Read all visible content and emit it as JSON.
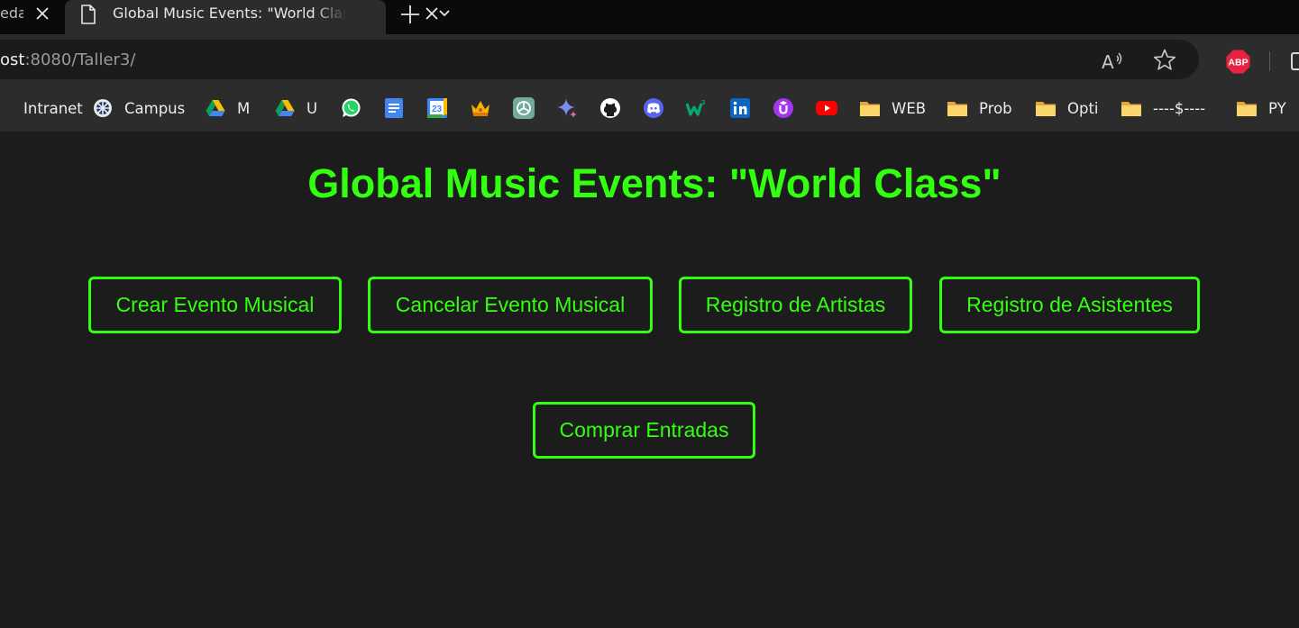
{
  "browser": {
    "tabs": [
      {
        "title": "eda",
        "active": false
      },
      {
        "title": "Global Music Events: \"World Class\"",
        "active": true
      }
    ],
    "address": {
      "host": "ost",
      "path": ":8080/Taller3/"
    },
    "extensions": {
      "abp_label": "ABP"
    },
    "bookmarks": [
      {
        "label": "Intranet",
        "icon": "partial-icon"
      },
      {
        "label": "Campus",
        "icon": "wheel-icon"
      },
      {
        "label": "M",
        "icon": "google-drive-icon"
      },
      {
        "label": "U",
        "icon": "google-drive-icon"
      },
      {
        "label": "",
        "icon": "whatsapp-icon"
      },
      {
        "label": "",
        "icon": "google-docs-icon"
      },
      {
        "label": "",
        "icon": "google-calendar-icon"
      },
      {
        "label": "",
        "icon": "crown-icon"
      },
      {
        "label": "",
        "icon": "chatgpt-icon"
      },
      {
        "label": "",
        "icon": "gemini-icon"
      },
      {
        "label": "",
        "icon": "github-icon"
      },
      {
        "label": "",
        "icon": "discord-icon"
      },
      {
        "label": "",
        "icon": "w3schools-icon"
      },
      {
        "label": "",
        "icon": "linkedin-icon"
      },
      {
        "label": "",
        "icon": "udemy-icon"
      },
      {
        "label": "",
        "icon": "youtube-icon"
      },
      {
        "label": "WEB",
        "icon": "folder-icon"
      },
      {
        "label": "Prob",
        "icon": "folder-icon"
      },
      {
        "label": "Opti",
        "icon": "folder-icon"
      },
      {
        "label": "----$----",
        "icon": "folder-icon"
      },
      {
        "label": "PY",
        "icon": "folder-icon"
      }
    ],
    "calendar_day": "23"
  },
  "page": {
    "title": "Global Music Events: \"World Class\"",
    "buttons": {
      "crear": "Crear Evento Musical",
      "cancelar": "Cancelar Evento Musical",
      "artistas": "Registro de Artistas",
      "asistentes": "Registro de Asistentes",
      "comprar": "Comprar Entradas"
    },
    "colors": {
      "accent": "#33ff11",
      "background": "#1c1c1c"
    }
  }
}
